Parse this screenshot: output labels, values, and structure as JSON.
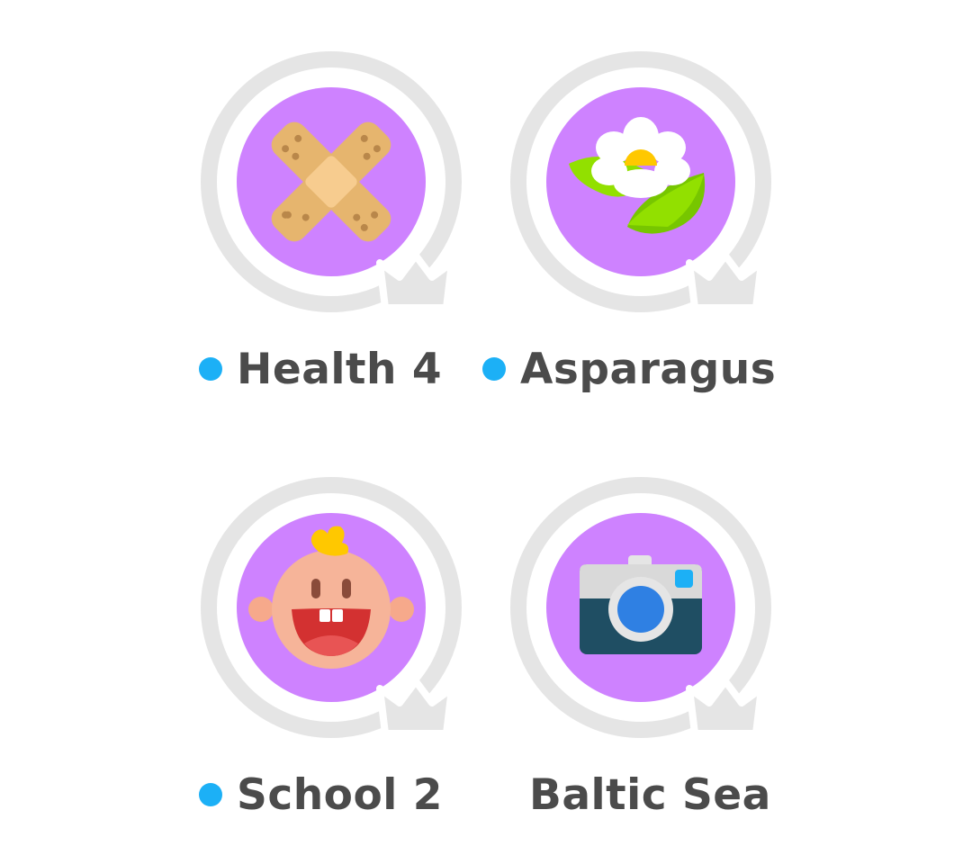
{
  "skills": [
    {
      "name": "Health 4",
      "icon": "bandage-icon",
      "new_dot": true
    },
    {
      "name": "Asparagus",
      "icon": "flower-icon",
      "new_dot": true
    },
    {
      "name": "School 2",
      "icon": "baby-icon",
      "new_dot": true
    },
    {
      "name": "Baltic Sea",
      "icon": "camera-icon",
      "new_dot": false
    }
  ],
  "colors": {
    "circle_fill": "#ce82ff",
    "ring": "#e5e5e5",
    "crown": "#e5e5e5",
    "new_dot": "#1cb0f6",
    "label_text": "#4b4b4b"
  }
}
